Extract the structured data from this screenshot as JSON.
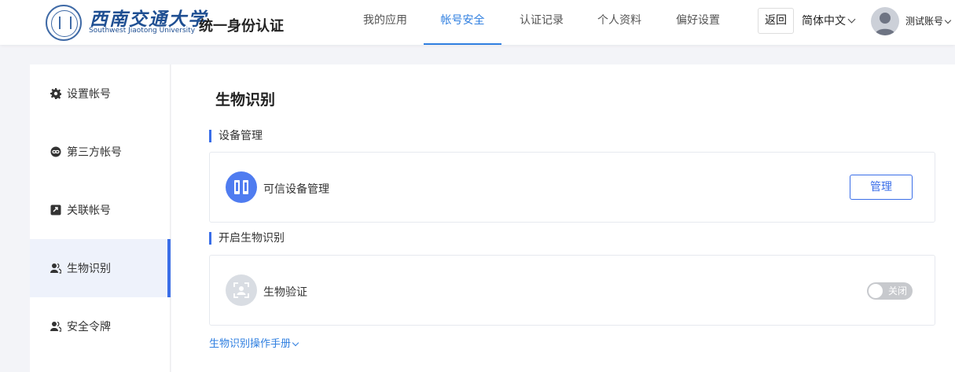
{
  "header": {
    "logo_name": "西南交通大学",
    "logo_name_en": "Southwest Jiaotong University",
    "site_title": "统一身份认证",
    "nav": [
      {
        "label": "我的应用",
        "active": false
      },
      {
        "label": "帐号安全",
        "active": true
      },
      {
        "label": "认证记录",
        "active": false
      },
      {
        "label": "个人资料",
        "active": false
      },
      {
        "label": "偏好设置",
        "active": false
      }
    ],
    "back_label": "返回",
    "language": "简体中文",
    "username": "测试账号",
    "accent_color": "#2f7fe0"
  },
  "sidebar": {
    "items": [
      {
        "label": "设置帐号",
        "icon": "gear-icon",
        "active": false
      },
      {
        "label": "第三方帐号",
        "icon": "link-icon",
        "active": false
      },
      {
        "label": "关联帐号",
        "icon": "linked-account-icon",
        "active": false
      },
      {
        "label": "生物识别",
        "icon": "users-icon",
        "active": true
      },
      {
        "label": "安全令牌",
        "icon": "users-icon",
        "active": false
      }
    ]
  },
  "main": {
    "title": "生物识别",
    "device_section": {
      "label": "设备管理",
      "card_label": "可信设备管理",
      "button_label": "管理"
    },
    "bio_section": {
      "label": "开启生物识别",
      "card_label": "生物验证",
      "toggle_label": "关闭",
      "toggle_on": false
    },
    "manual_link": "生物识别操作手册"
  }
}
